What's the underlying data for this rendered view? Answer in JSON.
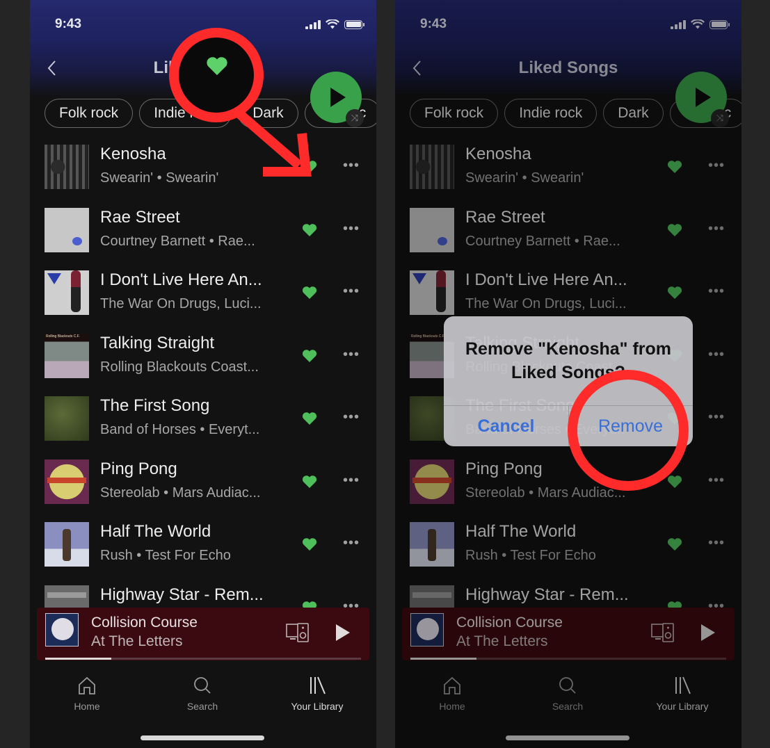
{
  "screens": [
    {
      "status_time": "9:43",
      "header_title": "Liked Songs",
      "filters": [
        "Folk rock",
        "Indie rock",
        "Dark",
        "Classic"
      ],
      "tracks": [
        {
          "title": "Kenosha",
          "subtitle": "Swearin' • Swearin'",
          "liked": true
        },
        {
          "title": "Rae Street",
          "subtitle": "Courtney Barnett • Rae...",
          "liked": true
        },
        {
          "title": "I Don't Live Here An...",
          "subtitle": "The War On Drugs, Luci...",
          "liked": true
        },
        {
          "title": "Talking Straight",
          "subtitle": "Rolling Blackouts Coast...",
          "liked": true
        },
        {
          "title": "The First Song",
          "subtitle": "Band of Horses • Everyt...",
          "liked": true
        },
        {
          "title": "Ping Pong",
          "subtitle": "Stereolab • Mars Audiac...",
          "liked": true
        },
        {
          "title": "Half The World",
          "subtitle": "Rush • Test For Echo",
          "liked": true
        },
        {
          "title": "Highway Star - Rem...",
          "subtitle": "",
          "liked": true
        }
      ],
      "now_playing": {
        "title": "Collision Course",
        "artist": "At The Letters",
        "progress": 0.21
      },
      "tabs": [
        {
          "label": "Home",
          "icon": "home-icon",
          "active": false
        },
        {
          "label": "Search",
          "icon": "search-icon",
          "active": false
        },
        {
          "label": "Your Library",
          "icon": "library-icon",
          "active": true
        }
      ]
    },
    {
      "status_time": "9:43",
      "header_title": "Liked Songs",
      "filters": [
        "Folk rock",
        "Indie rock",
        "Dark",
        "Classic"
      ],
      "tracks": [
        {
          "title": "Kenosha",
          "subtitle": "Swearin' • Swearin'",
          "liked": true
        },
        {
          "title": "Rae Street",
          "subtitle": "Courtney Barnett • Rae...",
          "liked": true
        },
        {
          "title": "I Don't Live Here An...",
          "subtitle": "The War On Drugs, Luci...",
          "liked": true
        },
        {
          "title": "Talking Straight",
          "subtitle": "Rolling Blackouts Coast...",
          "liked": true
        },
        {
          "title": "The First Song",
          "subtitle": "Band of Horses • Everyt...",
          "liked": true
        },
        {
          "title": "Ping Pong",
          "subtitle": "Stereolab • Mars Audiac...",
          "liked": true
        },
        {
          "title": "Half The World",
          "subtitle": "Rush • Test For Echo",
          "liked": true
        },
        {
          "title": "Highway Star - Rem...",
          "subtitle": "",
          "liked": true
        }
      ],
      "now_playing": {
        "title": "Collision Course",
        "artist": "At The Letters",
        "progress": 0.21
      },
      "tabs": [
        {
          "label": "Home",
          "icon": "home-icon",
          "active": false
        },
        {
          "label": "Search",
          "icon": "search-icon",
          "active": false
        },
        {
          "label": "Your Library",
          "icon": "library-icon",
          "active": true
        }
      ],
      "alert": {
        "message": "Remove \"Kenosha\" from Liked Songs?",
        "cancel_label": "Cancel",
        "confirm_label": "Remove"
      }
    }
  ],
  "colors": {
    "spotify_green": "#3aa14b",
    "heart_green": "#4fbf5c",
    "annotation_red": "#ff2a2a",
    "ios_blue": "#3a6fd8",
    "mini_player_bg": "#3b0a10"
  },
  "icons": {
    "back": "chevron-left-icon",
    "play": "play-icon",
    "shuffle": "shuffle-icon",
    "heart": "heart-icon",
    "more": "more-options-icon",
    "devices": "devices-icon"
  }
}
